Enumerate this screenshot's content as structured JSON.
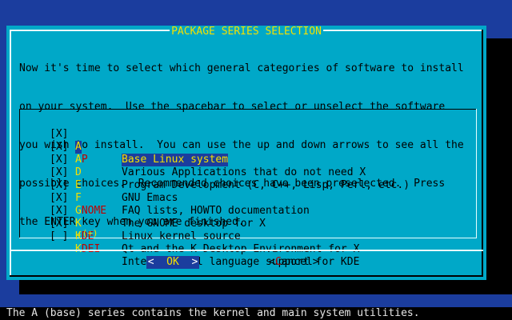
{
  "dialog": {
    "title": "PACKAGE SERIES SELECTION",
    "intro_lines": [
      "Now it's time to select which general categories of software to install",
      "on your system.  Use the spacebar to select or unselect the software",
      "you wish to install.  You can use the up and down arrows to see all the",
      "possible choices.  Recommended choices have been preselected.  Press",
      "the ENTER key when you are finished."
    ],
    "items": [
      {
        "check": "[X]",
        "tag_first": "A",
        "tag_rest": "",
        "desc": "Base Linux system"
      },
      {
        "check": "[X]",
        "tag_first": "A",
        "tag_rest": "P",
        "desc": "Various Applications that do not need X"
      },
      {
        "check": "[X]",
        "tag_first": "D",
        "tag_rest": "",
        "desc": "Program Development (C, C++, Lisp, Perl, etc.)"
      },
      {
        "check": "[X]",
        "tag_first": "E",
        "tag_rest": "",
        "desc": "GNU Emacs"
      },
      {
        "check": "[X]",
        "tag_first": "F",
        "tag_rest": "",
        "desc": "FAQ lists, HOWTO documentation"
      },
      {
        "check": "[X]",
        "tag_first": "G",
        "tag_rest": "NOME",
        "desc": "The GNOME desktop for X"
      },
      {
        "check": "[X]",
        "tag_first": "K",
        "tag_rest": "",
        "desc": "Linux kernel source"
      },
      {
        "check": "[X]",
        "tag_first": "K",
        "tag_rest": "DE",
        "desc": "Qt and the K Desktop Environment for X"
      },
      {
        "check": "[ ]",
        "tag_first": "K",
        "tag_rest": "DEI",
        "desc": "International language support for KDE"
      }
    ],
    "more_indicator": "↓(+)",
    "ok_left": "<",
    "ok_label": "OK",
    "ok_right": ">",
    "cancel_left": "<",
    "cancel_hotkey": "C",
    "cancel_rest": "ancel",
    "cancel_right": ">"
  },
  "statusbar": {
    "text": "The A (base) series contains the kernel and main system utilities."
  },
  "colors": {
    "background": "#1b3d9e",
    "dialog": "#00a8c8",
    "title": "#f4e000",
    "hotkey": "#c00000"
  }
}
